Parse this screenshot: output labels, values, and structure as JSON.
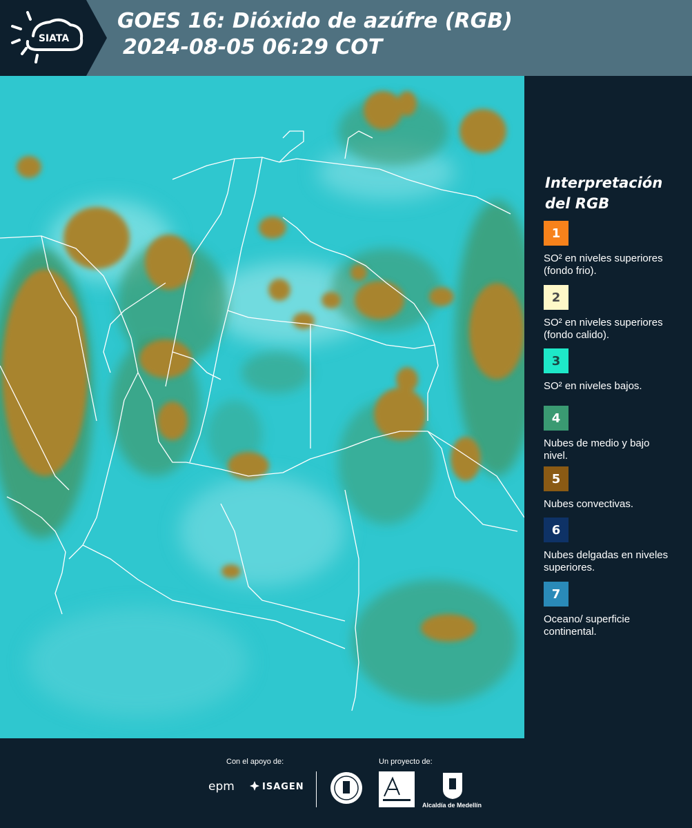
{
  "header": {
    "brand": "SIATA",
    "title_line1": "GOES 16: Dióxido de azúfre (RGB)",
    "title_line2": "2024-08-05 06:29 COT"
  },
  "legend": {
    "title": "Interpretación del RGB",
    "items": [
      {
        "number": "1",
        "color": "#f7821b",
        "text_color": "#ffffff",
        "label": "SO² en niveles superiores (fondo frio)."
      },
      {
        "number": "2",
        "color": "#fef8c8",
        "text_color": "#4a4a4a",
        "label": "SO² en niveles superiores (fondo calido)."
      },
      {
        "number": "3",
        "color": "#1ee8c8",
        "text_color": "#1a4a45",
        "label": "SO² en niveles bajos."
      },
      {
        "number": "4",
        "color": "#3a9a72",
        "text_color": "#ffffff",
        "label": "Nubes de medio y bajo nivel."
      },
      {
        "number": "5",
        "color": "#8a5a14",
        "text_color": "#ffffff",
        "label": "Nubes convectivas."
      },
      {
        "number": "6",
        "color": "#0e3266",
        "text_color": "#ffffff",
        "label": "Nubes delgadas en niveles superiores."
      },
      {
        "number": "7",
        "color": "#2a8ab8",
        "text_color": "#ffffff",
        "label": "Oceano/ superficie continental."
      }
    ]
  },
  "footer": {
    "support_label": "Con el apoyo de:",
    "project_label": "Un proyecto de:",
    "sponsor_epm": "epm",
    "sponsor_isagen": "ISAGEN",
    "partner_alcaldia": "Alcaldía de Medellín"
  },
  "colors": {
    "background": "#0d1f2d",
    "header": "#4f7180",
    "map_base": "#2fc7cf",
    "cloud_convective": "#a8842e",
    "cloud_mid_low": "#3f9a6e"
  }
}
